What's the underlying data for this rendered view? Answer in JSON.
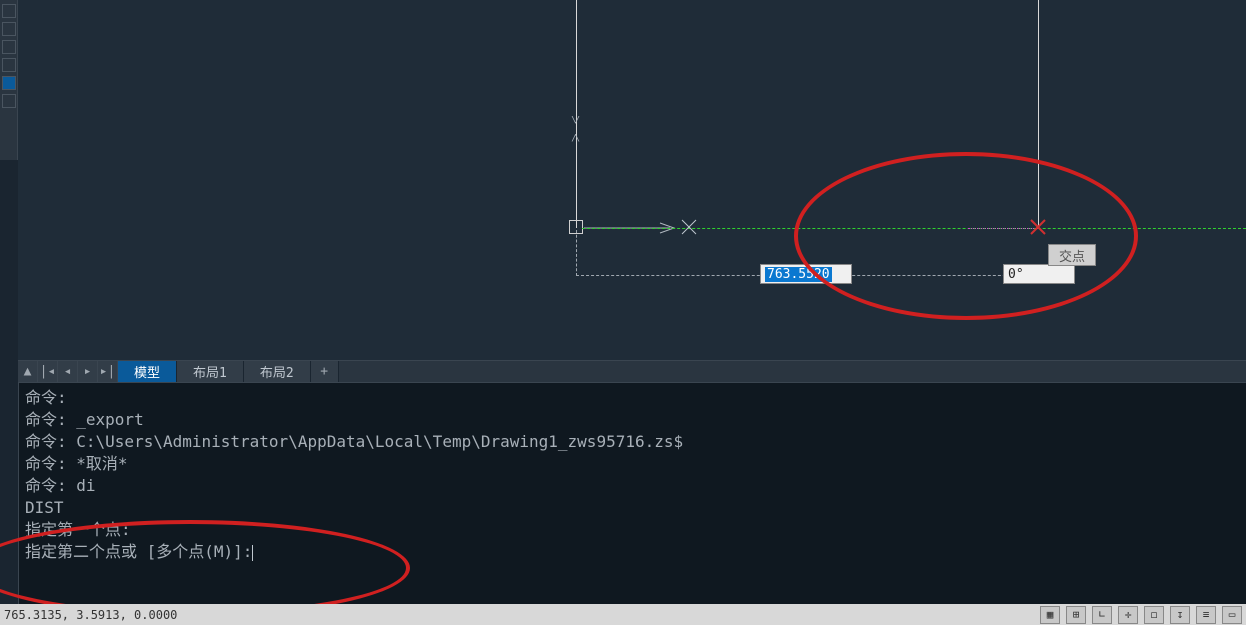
{
  "tabs": {
    "model": "模型",
    "layout1": "布局1",
    "layout2": "布局2",
    "plus": "+"
  },
  "dynamic_input": {
    "distance": "763.5520",
    "angle": "0°"
  },
  "snap_tooltip": "交点",
  "command_lines": {
    "l0": "命令:",
    "l1": "命令: _export",
    "l2": "命令: C:\\Users\\Administrator\\AppData\\Local\\Temp\\Drawing1_zws95716.zs$",
    "l3": "命令: *取消*",
    "l4": "命令: di",
    "l5": "DIST",
    "l6": "指定第一个点:",
    "l7": "指定第二个点或 [多个点(M)]:"
  },
  "status": {
    "coords": "765.3135, 3.5913, 0.0000"
  }
}
